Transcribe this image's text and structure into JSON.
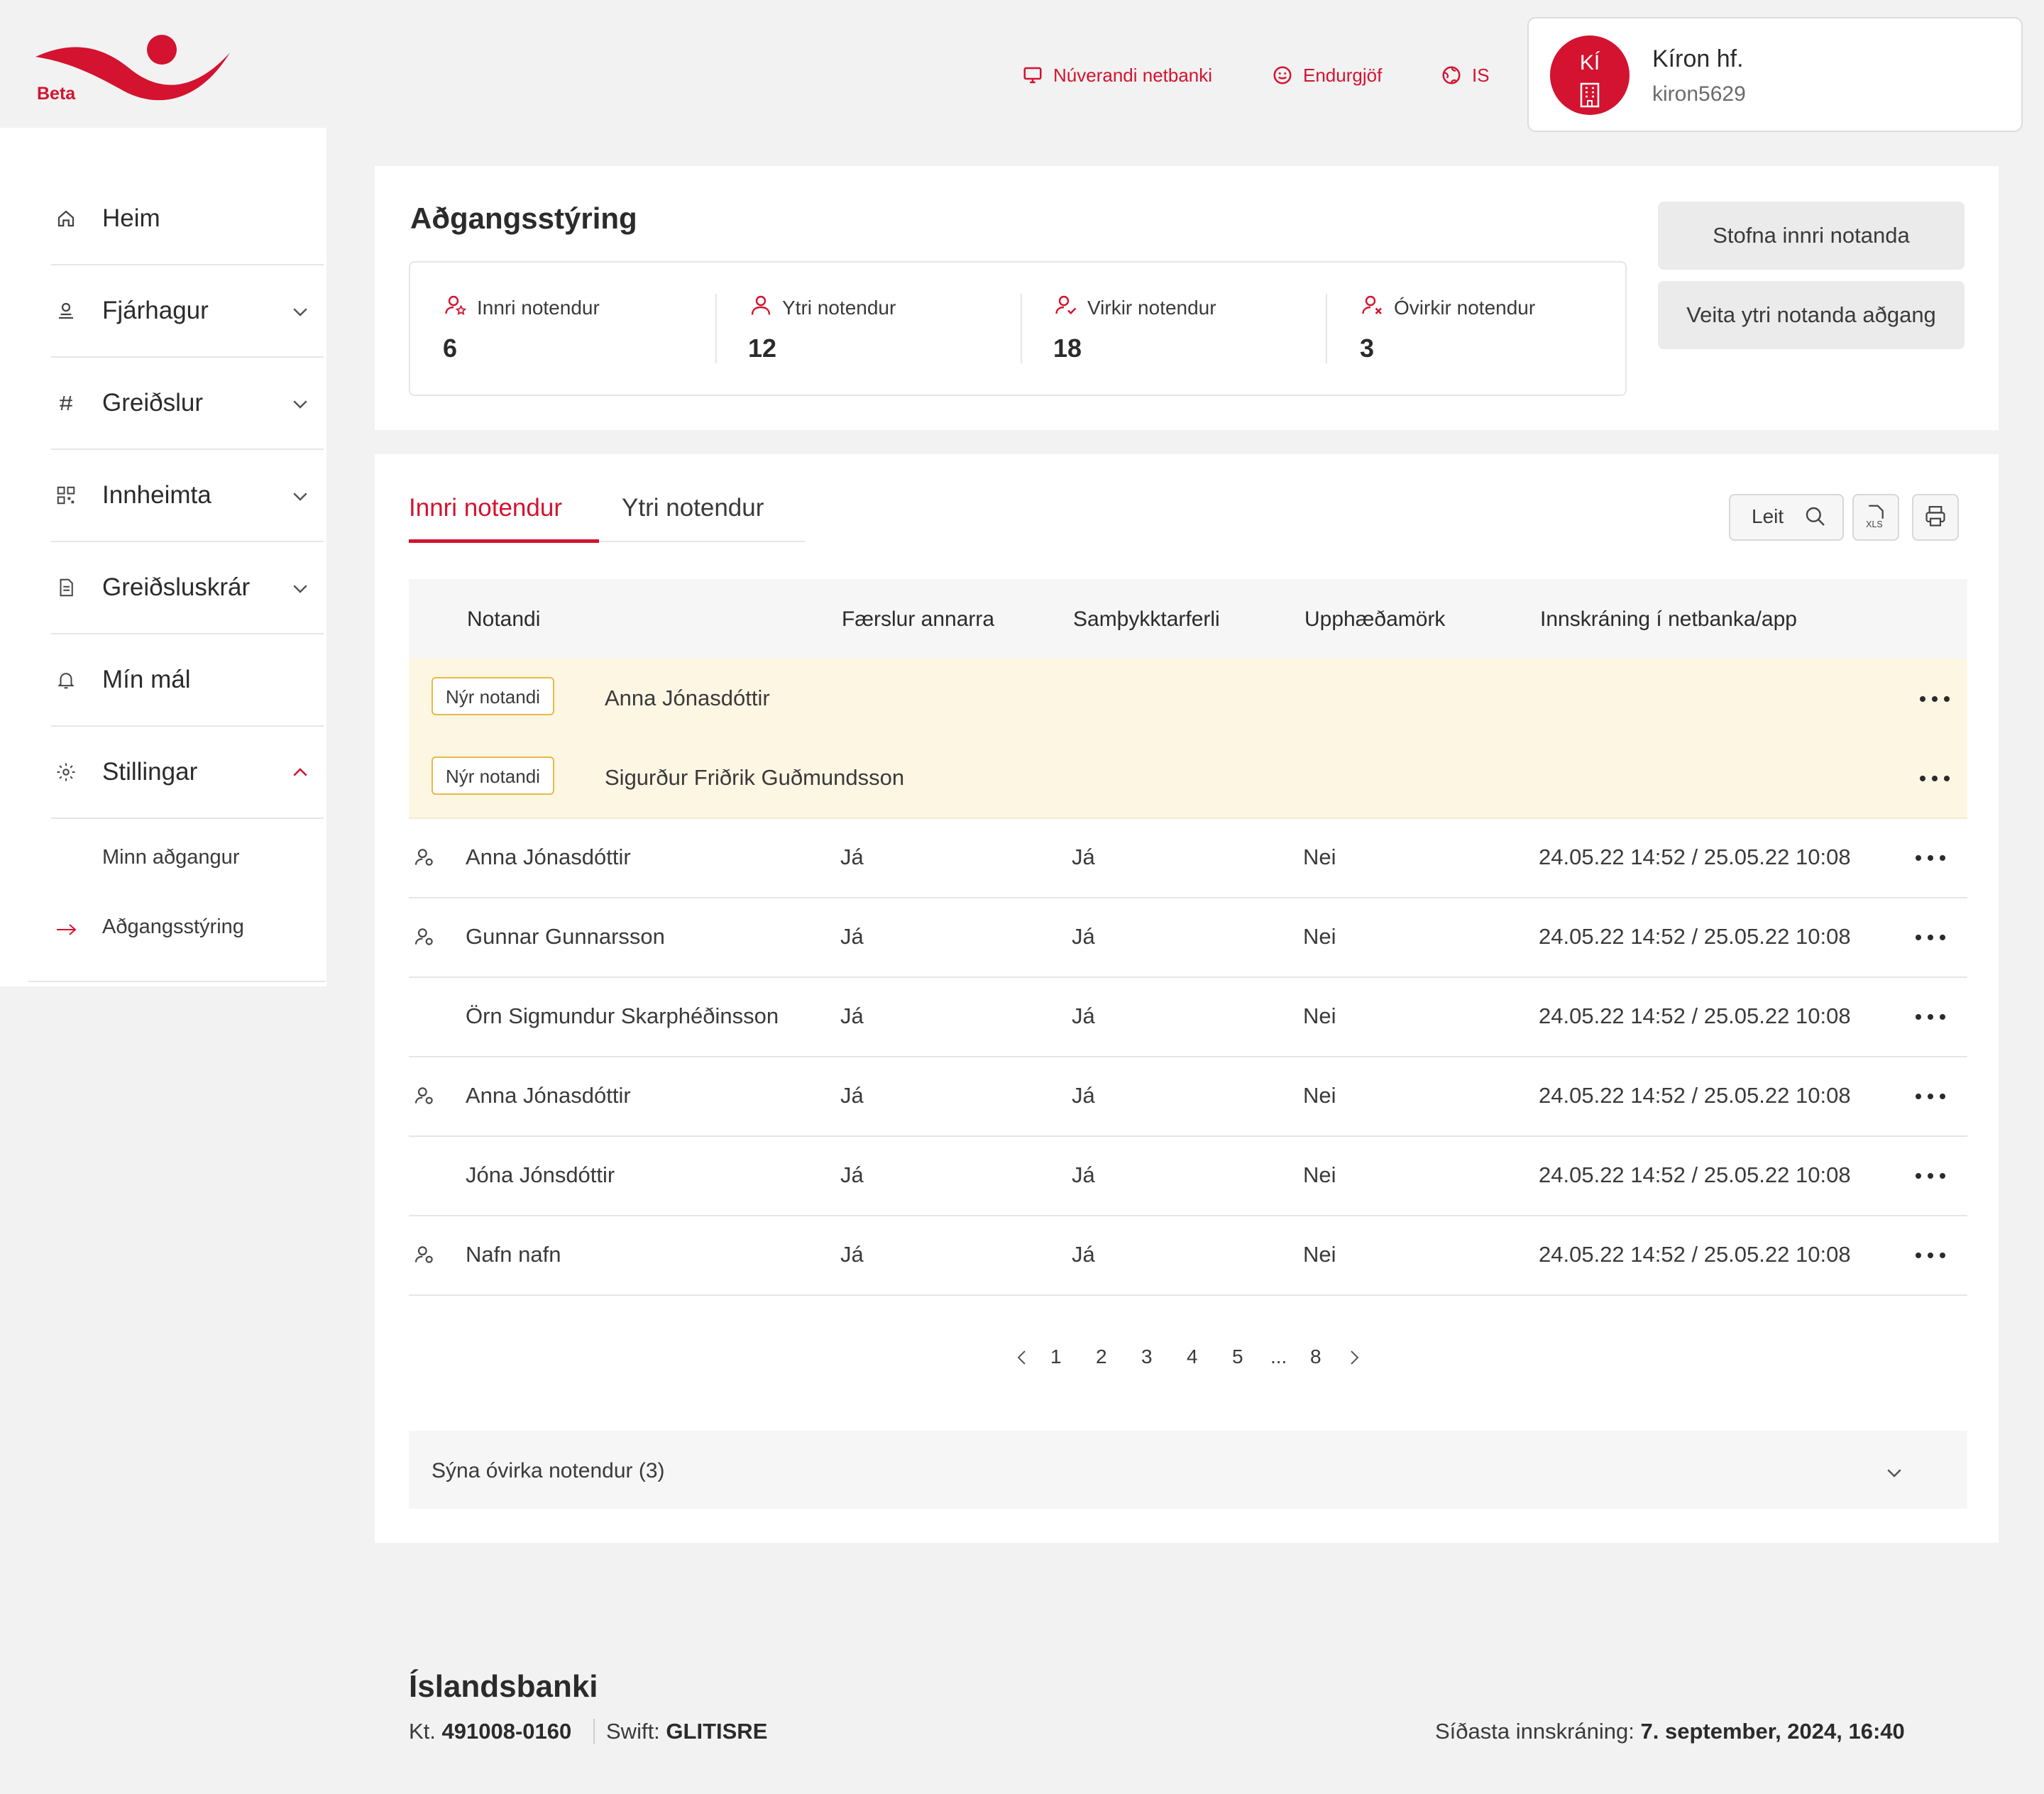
{
  "brand": {
    "beta_label": "Beta",
    "accent_color": "#d3132f"
  },
  "header": {
    "links": [
      {
        "label": "Núverandi netbanki",
        "icon": "monitor-icon"
      },
      {
        "label": "Endurgjöf",
        "icon": "smiley-icon"
      },
      {
        "label": "IS",
        "icon": "globe-icon"
      }
    ],
    "user": {
      "initials": "KÍ",
      "name": "Kíron hf.",
      "username": "kiron5629"
    }
  },
  "sidebar": {
    "items": [
      {
        "label": "Heim",
        "icon": "home-icon"
      },
      {
        "label": "Fjárhagur",
        "icon": "finance-icon"
      },
      {
        "label": "Greiðslur",
        "icon": "payments-icon"
      },
      {
        "label": "Innheimta",
        "icon": "collection-icon"
      },
      {
        "label": "Greiðsluskrár",
        "icon": "payment-files-icon"
      },
      {
        "label": "Mín mál",
        "icon": "bell-icon"
      },
      {
        "label": "Stillingar",
        "icon": "gear-icon"
      }
    ],
    "subitems": [
      {
        "label": "Minn aðgangur"
      },
      {
        "label": "Aðgangsstýring",
        "active": true
      }
    ]
  },
  "access": {
    "title": "Aðgangsstýring",
    "stats": [
      {
        "label": "Innri notendur",
        "value": "6"
      },
      {
        "label": "Ytri notendur",
        "value": "12"
      },
      {
        "label": "Virkir notendur",
        "value": "18"
      },
      {
        "label": "Óvirkir notendur",
        "value": "3"
      }
    ],
    "buttons": {
      "create_internal": "Stofna innri  notanda",
      "grant_external": "Veita ytri notanda aðgang"
    }
  },
  "users": {
    "tabs": [
      {
        "label": "Innri notendur",
        "active": true
      },
      {
        "label": "Ytri  notendur"
      }
    ],
    "search_label": "Leit",
    "columns": [
      "Notandi",
      "Færslur annarra",
      "Samþykktarferli",
      "Upphæðamörk",
      "Innskráning  í netbanka/app"
    ],
    "new_rows": [
      {
        "badge": "Nýr notandi",
        "name": "Anna Jónasdóttir"
      },
      {
        "badge": "Nýr notandi",
        "name": "Sigurður Friðrik Guðmundsson"
      }
    ],
    "rows": [
      {
        "name": "Anna Jónasdóttir",
        "others": "Já",
        "approval": "Já",
        "limits": "Nei",
        "login": "24.05.22 14:52 / 25.05.22 10:08",
        "has_icon": true
      },
      {
        "name": "Gunnar Gunnarsson",
        "others": "Já",
        "approval": "Já",
        "limits": "Nei",
        "login": "24.05.22 14:52 / 25.05.22 10:08",
        "has_icon": true
      },
      {
        "name": "Örn Sigmundur Skarphéðinsson",
        "others": "Já",
        "approval": "Já",
        "limits": "Nei",
        "login": "24.05.22 14:52 / 25.05.22 10:08",
        "has_icon": false
      },
      {
        "name": "Anna Jónasdóttir",
        "others": "Já",
        "approval": "Já",
        "limits": "Nei",
        "login": "24.05.22 14:52 / 25.05.22 10:08",
        "has_icon": true
      },
      {
        "name": "Jóna Jónsdóttir",
        "others": "Já",
        "approval": "Já",
        "limits": "Nei",
        "login": "24.05.22 14:52 / 25.05.22 10:08",
        "has_icon": false
      },
      {
        "name": "Nafn nafn",
        "others": "Já",
        "approval": "Já",
        "limits": "Nei",
        "login": "24.05.22 14:52 / 25.05.22 10:08",
        "has_icon": true
      }
    ],
    "pagination": {
      "pages": [
        "1",
        "2",
        "3",
        "4",
        "5",
        "...",
        "8"
      ],
      "current": "1"
    },
    "show_inactive": "Sýna óvirka notendur (3)"
  },
  "footer": {
    "brand": "Íslandsbanki",
    "kt_label": "Kt.",
    "kt_value": "491008-0160",
    "swift_label": "Swift:",
    "swift_value": "GLITISRE",
    "last_login_label": "Síðasta innskráning:",
    "last_login_value": "7. september, 2024, 16:40"
  }
}
